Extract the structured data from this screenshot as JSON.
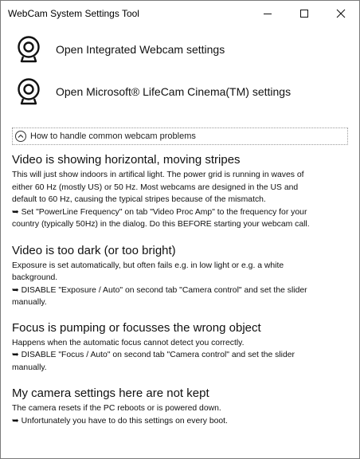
{
  "window": {
    "title": "WebCam System Settings Tool",
    "controls": {
      "minimize": "—",
      "maximize": "☐",
      "close": "✕"
    }
  },
  "cameras": [
    {
      "label": "Open Integrated Webcam settings",
      "icon": "webcam-icon"
    },
    {
      "label": "Open Microsoft® LifeCam Cinema(TM) settings",
      "icon": "webcam-icon"
    }
  ],
  "expander": {
    "label": "How to handle common webcam problems",
    "icon": "collapse-chevron-icon"
  },
  "sections": [
    {
      "heading": "Video is showing horizontal, moving stripes",
      "lines": [
        "This will just show indoors in artifical light. The power grid is running in waves of",
        "either 60 Hz (mostly US) or 50 Hz. Most webcams are designed in the US and",
        "default to 60 Hz, causing the typical stripes because of the mismatch.",
        "➥ Set \"PowerLine Frequency\" on tab \"Video Proc Amp\" to the frequency for your",
        "country (typically 50Hz) in the dialog. Do this BEFORE starting your webcam call."
      ]
    },
    {
      "heading": "Video is too dark (or too bright)",
      "lines": [
        "Exposure is set automatically, but often fails e.g. in low light or e.g. a white",
        "background.",
        "➥ DISABLE \"Exposure / Auto\" on second tab \"Camera control\" and set the slider",
        "manually."
      ]
    },
    {
      "heading": "Focus is pumping or focusses the wrong object",
      "lines": [
        "Happens when the automatic focus cannot detect you correctly.",
        "➥ DISABLE \"Focus / Auto\" on second tab \"Camera control\" and set the slider",
        "manually."
      ]
    },
    {
      "heading": "My camera settings here are not kept",
      "lines": [
        "The camera resets if the PC reboots or is powered down.",
        "➥ Unfortunately you have to do this settings on every boot."
      ]
    }
  ]
}
